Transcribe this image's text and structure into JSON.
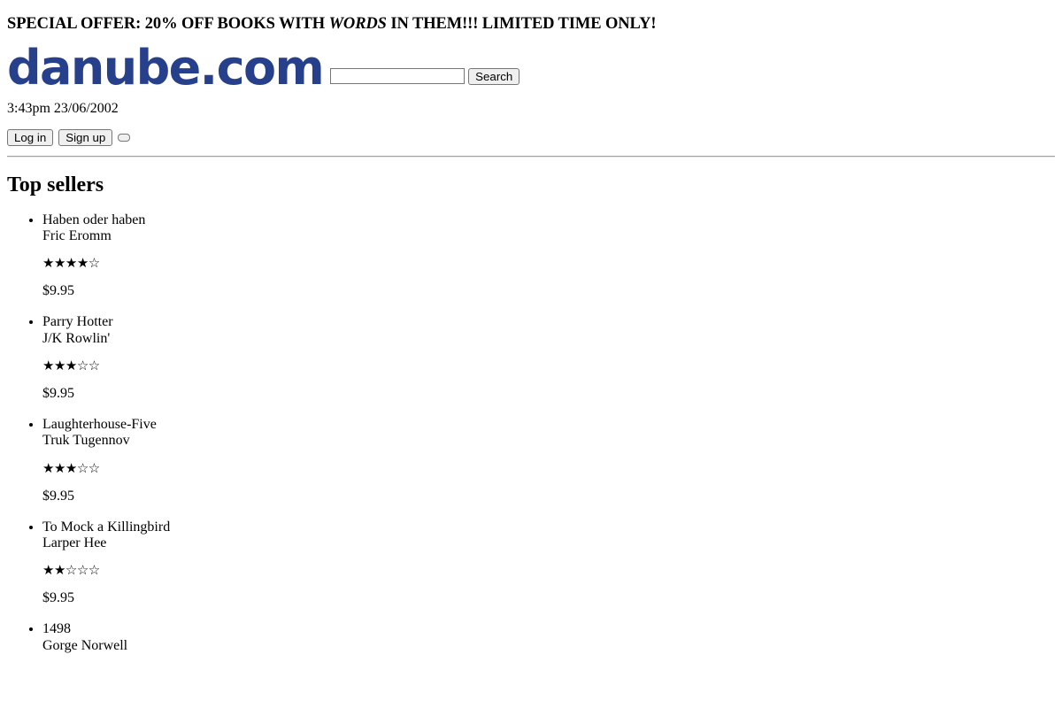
{
  "banner": {
    "prefix": "SPECIAL OFFER: 20% OFF BOOKS WITH ",
    "emphasis": "WORDS",
    "suffix": " IN THEM!!! LIMITED TIME ONLY!"
  },
  "header": {
    "logo": "danube.com",
    "search": {
      "value": "",
      "placeholder": "",
      "button_label": "Search"
    },
    "timestamp": "3:43pm 23/06/2002",
    "account": {
      "login_label": "Log in",
      "signup_label": "Sign up",
      "extra_button_label": ""
    }
  },
  "main": {
    "section_title": "Top sellers",
    "books": [
      {
        "title": "Haben oder haben",
        "author": "Fric Eromm",
        "rating": 4,
        "rating_max": 5,
        "stars": "★★★★☆",
        "price": "$9.95"
      },
      {
        "title": "Parry Hotter",
        "author": "J/K Rowlin'",
        "rating": 3,
        "rating_max": 5,
        "stars": "★★★☆☆",
        "price": "$9.95"
      },
      {
        "title": "Laughterhouse-Five",
        "author": "Truk Tugennov",
        "rating": 3,
        "rating_max": 5,
        "stars": "★★★☆☆",
        "price": "$9.95"
      },
      {
        "title": "To Mock a Killingbird",
        "author": "Larper Hee",
        "rating": 2,
        "rating_max": 5,
        "stars": "★★☆☆☆",
        "price": "$9.95"
      },
      {
        "title": "1498",
        "author": "Gorge Norwell",
        "rating": 0,
        "rating_max": 5,
        "stars": "",
        "price": ""
      }
    ]
  },
  "colors": {
    "logo": "#27408b",
    "text": "#000000",
    "background": "#ffffff",
    "button_face": "#efefef",
    "border": "#767676"
  }
}
